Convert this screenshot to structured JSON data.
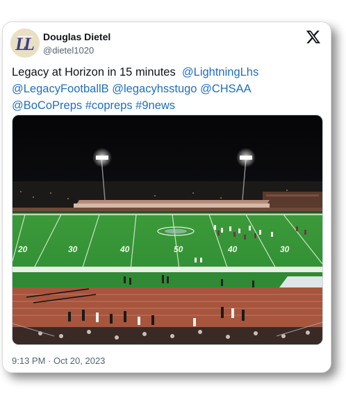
{
  "author": {
    "name": "Douglas Dietel",
    "handle": "@dietel1020",
    "avatar_letters": "LL"
  },
  "platform_icon": "x-logo-icon",
  "tweet": {
    "text_plain": "Legacy at Horizon in 15 minutes",
    "mentions_line1": "@LightningLhs",
    "mentions_line2": "@LegacyFootballB @legacyhsstugo @CHSAA",
    "mentions_line3": "@BoCoPreps #copreps #9news"
  },
  "photo": {
    "yard_numbers": [
      "20",
      "30",
      "40",
      "50",
      "40",
      "30"
    ]
  },
  "timestamp": "9:13 PM · Oct 20, 2023",
  "colors": {
    "link": "#1d6fc1",
    "text": "#0f1419",
    "secondary": "#536471",
    "field_green": "#3aa83a",
    "track": "#a8553a"
  }
}
